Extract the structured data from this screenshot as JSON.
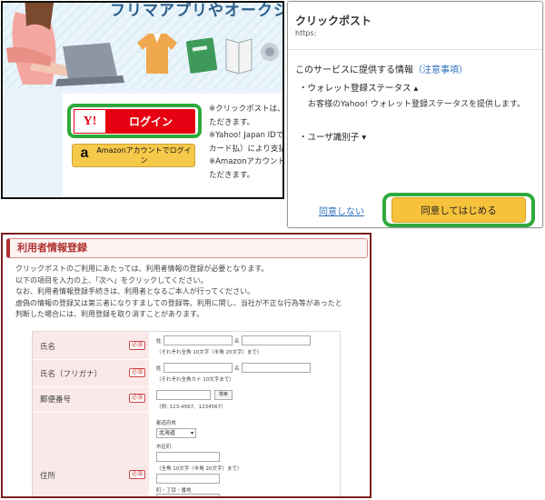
{
  "login_panel": {
    "headline": "フリマアプリやオークショ",
    "yahoo_logo": "Y!",
    "yahoo_label": "ログイン",
    "amazon_logo": "a",
    "amazon_label": "Amazonアカウントでログイン",
    "notes": [
      "※クリックポストは、",
      "ただきます。",
      "※Yahoo! Japan IDで",
      "カード払）により支払",
      "※Amazonアカウント",
      "ただきます。"
    ]
  },
  "consent_dialog": {
    "app_name": "クリックポスト",
    "app_url": "https:",
    "info_heading": "このサービスに提供する情報",
    "info_link": "（注意事項）",
    "item1": "・ウォレット登録ステータス ▴",
    "item1_desc": "お客様のYahoo! ウォレット登録ステータスを提供します。",
    "item2": "・ユーザ識別子 ▾",
    "decline_label": "同意しない",
    "agree_label": "同意してはじめる"
  },
  "registration_form": {
    "title": "利用者情報登録",
    "intro": [
      "クリックポストのご利用にあたっては、利用者情報の登録が必要となります。",
      "以下の項目を入力の上、「次へ」をクリックしてください。",
      "なお、利用者情報登録手続きは、利用者となるご本人が行ってください。",
      "虚偽の情報の登録又は第三者になりすましての登録等、利用に関し、当社が不正な行為等があったと",
      "判断した場合には、利用登録を取り消すことがあります。"
    ],
    "required_badge": "必須",
    "fields": {
      "name_label": "氏名",
      "name_sei": "姓",
      "name_mei": "名",
      "name_note": "（それぞれ全角 10文字（半角 20文字）まで）",
      "kana_label": "氏名（フリガナ）",
      "kana_sei": "姓",
      "kana_mei": "名",
      "kana_note": "（それぞれ全角カナ 10文字まで）",
      "postal_label": "郵便番号",
      "postal_search": "検索",
      "postal_note": "（例: 123-4567、1234567）",
      "address_label": "住所",
      "prefecture_caption": "都道府県",
      "prefecture_value": "北海道",
      "city_caption": "市区町",
      "city_note": "（全角 10文字（半角 20文字）まで）",
      "street_caption": "町・丁目・番地"
    }
  },
  "colors": {
    "yahoo_red": "#e60012",
    "highlight_green": "#2eaa3c",
    "amazon_yellow": "#f6c94a",
    "agree_yellow": "#f6c23b",
    "form_title_red": "#b03030"
  }
}
